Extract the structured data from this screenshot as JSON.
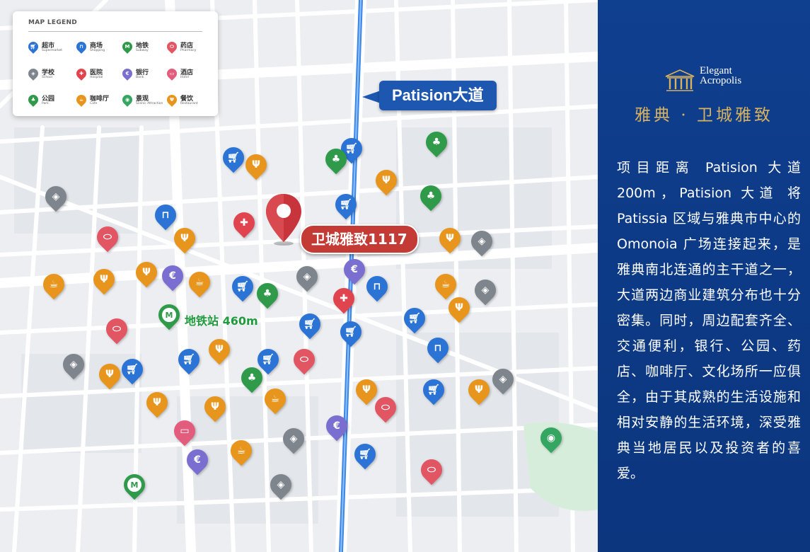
{
  "legend": {
    "title": "MAP LEGEND",
    "items": [
      {
        "key": "supermarket",
        "zh": "超市",
        "en": "Supermarket",
        "icon": "cart-icon",
        "color": "#2b74d6"
      },
      {
        "key": "shopping",
        "zh": "商场",
        "en": "Shopping",
        "icon": "shopping-bag-icon",
        "color": "#2b74d6"
      },
      {
        "key": "subway",
        "zh": "地铁",
        "en": "Subway",
        "icon": "metro-icon",
        "color": "#2f9a4a"
      },
      {
        "key": "pharmacy",
        "zh": "药店",
        "en": "Pharmacy",
        "icon": "pill-icon",
        "color": "#e25563"
      },
      {
        "key": "school",
        "zh": "学校",
        "en": "School",
        "icon": "graduation-cap-icon",
        "color": "#7e858d"
      },
      {
        "key": "hospital",
        "zh": "医院",
        "en": "Hospital",
        "icon": "medical-cross-icon",
        "color": "#e0454f"
      },
      {
        "key": "bank",
        "zh": "银行",
        "en": "Bank",
        "icon": "euro-icon",
        "color": "#7a6fd0"
      },
      {
        "key": "hotel",
        "zh": "酒店",
        "en": "Hotel",
        "icon": "bed-icon",
        "color": "#e25c7e"
      },
      {
        "key": "park",
        "zh": "公园",
        "en": "Park",
        "icon": "tree-icon",
        "color": "#2f9a4a"
      },
      {
        "key": "cafe",
        "zh": "咖啡厅",
        "en": "Cafe",
        "icon": "coffee-cup-icon",
        "color": "#e7951c"
      },
      {
        "key": "attraction",
        "zh": "景观",
        "en": "Scenic Attraction",
        "icon": "camera-icon",
        "color": "#35a661"
      },
      {
        "key": "restaurant",
        "zh": "餐饮",
        "en": "Restaurant",
        "icon": "fork-knife-icon",
        "color": "#e7951c"
      }
    ]
  },
  "map": {
    "road_label": "Patision大道",
    "project_label": "卫城雅致1117",
    "metro_label": "地铁站 460m"
  },
  "panel": {
    "logo_line1": "Elegant",
    "logo_line2": "Acropolis",
    "brand": "雅典 · 卫城雅致",
    "description": "项目距离 Patision 大道 200m，Patision 大道 将 Patissia 区域与雅典市中心的 Omonoia 广场连接起来，是雅典南北连通的主干道之一，大道两边商业建筑分布也十分密集。同时，周边配套齐全、交通便利，银行、公园、药店、咖啡厅、文化场所一应俱全，由于其成熟的生活设施和相对安静的生活环境，深受雅典当地居民以及投资者的喜爱。"
  }
}
